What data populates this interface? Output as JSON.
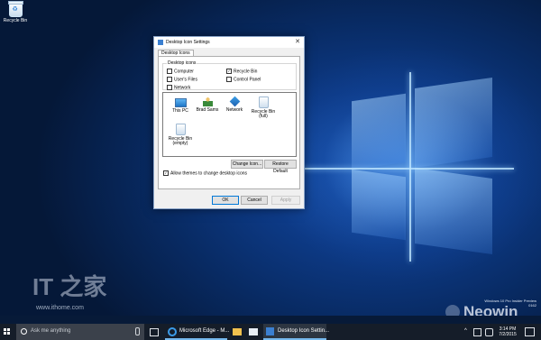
{
  "desktop": {
    "icon_label": "Recycle Bin",
    "watermarks": {
      "it_logo": "IT 之家",
      "it_url": "www.ithome.com",
      "neowin": "Neowin"
    },
    "build_watermark": [
      "Windows 10 Pro Insider Preview",
      "0162"
    ]
  },
  "dialog": {
    "title": "Desktop Icon Settings",
    "close_glyph": "✕",
    "tab": "Desktop Icons",
    "group_label": "Desktop icons",
    "checkboxes": [
      {
        "label": "Computer",
        "checked": false
      },
      {
        "label": "Recycle Bin",
        "checked": true
      },
      {
        "label": "User's Files",
        "checked": false
      },
      {
        "label": "Control Panel",
        "checked": false
      },
      {
        "label": "Network",
        "checked": false
      }
    ],
    "icon_list": [
      {
        "label": "This PC",
        "icon": "this-pc-icon"
      },
      {
        "label": "Brad Sams",
        "icon": "user-folder-icon"
      },
      {
        "label": "Network",
        "icon": "network-icon"
      },
      {
        "label": "Recycle Bin (full)",
        "icon": "recycle-bin-full-icon"
      },
      {
        "label": "Recycle Bin (empty)",
        "icon": "recycle-bin-empty-icon"
      }
    ],
    "change_icon_button": "Change Icon...",
    "restore_default_button": "Restore Default",
    "allow_themes_label": "Allow themes to change desktop icons",
    "allow_themes_checked": true,
    "ok_button": "OK",
    "cancel_button": "Cancel",
    "apply_button": "Apply",
    "check_glyph": "✓"
  },
  "taskbar": {
    "search_placeholder": "Ask me anything",
    "tasks": [
      {
        "label": "Microsoft Edge - M...",
        "icon": "edge-icon"
      },
      {
        "label": "Desktop Icon Settin...",
        "icon": "desktop-settings-icon"
      }
    ],
    "tray_up": "^",
    "time": "3:14 PM",
    "date": "7/2/2015"
  }
}
